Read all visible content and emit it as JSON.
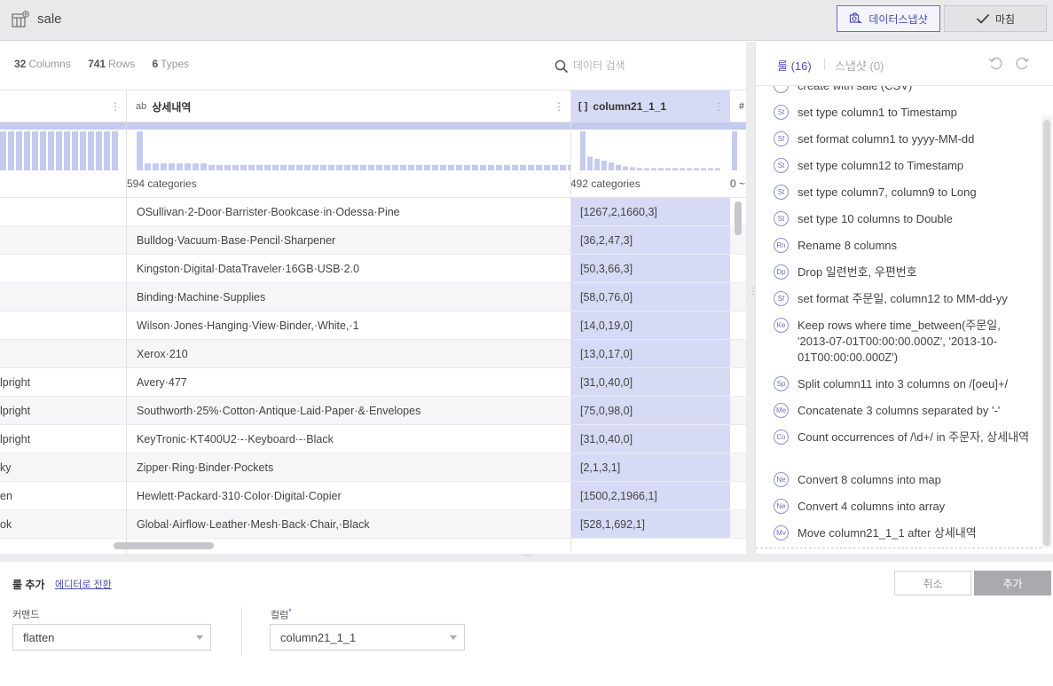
{
  "header": {
    "dataset_title": "sale",
    "snapshot_button": "데이터스냅샷",
    "finish_button": "마침"
  },
  "stats": {
    "columns_count": "32",
    "columns_label": "Columns",
    "rows_count": "741",
    "rows_label": "Rows",
    "types_count": "6",
    "types_label": "Types"
  },
  "search": {
    "placeholder": "데이터 검색"
  },
  "columns": [
    {
      "type": "ab",
      "name": "상세내역",
      "categories": "594 categories"
    },
    {
      "type": "[ ]",
      "name": "column21_1_1",
      "categories": "492 categories"
    },
    {
      "name": "#",
      "categories": "0 ~"
    }
  ],
  "rows": [
    {
      "left": "",
      "desc": "OSullivan·2-Door·Barrister·Bookcase·in·Odessa·Pine",
      "arr": "[1267,2,1660,3]"
    },
    {
      "left": "",
      "desc": "Bulldog·Vacuum·Base·Pencil·Sharpener",
      "arr": "[36,2,47,3]"
    },
    {
      "left": "",
      "desc": "Kingston·Digital·DataTraveler·16GB·USB·2.0",
      "arr": "[50,3,66,3]"
    },
    {
      "left": "",
      "desc": "Binding·Machine·Supplies",
      "arr": "[58,0,76,0]"
    },
    {
      "left": "",
      "desc": "Wilson·Jones·Hanging·View·Binder,·White,·1",
      "arr": "[14,0,19,0]"
    },
    {
      "left": "",
      "desc": "Xerox·210",
      "arr": "[13,0,17,0]"
    },
    {
      "left": "lpright",
      "desc": "Avery·477",
      "arr": "[31,0,40,0]"
    },
    {
      "left": "lpright",
      "desc": "Southworth·25%·Cotton·Antique·Laid·Paper·&·Envelopes",
      "arr": "[75,0,98,0]"
    },
    {
      "left": "lpright",
      "desc": "KeyTronic·KT400U2·-·Keyboard·-·Black",
      "arr": "[31,0,40,0]"
    },
    {
      "left": "ky",
      "desc": "Zipper·Ring·Binder·Pockets",
      "arr": "[2,1,3,1]"
    },
    {
      "left": "en",
      "desc": "Hewlett·Packard·310·Color·Digital·Copier",
      "arr": "[1500,2,1966,1]"
    },
    {
      "left": "ok",
      "desc": "Global·Airflow·Leather·Mesh·Back·Chair,·Black",
      "arr": "[528,1,692,1]"
    }
  ],
  "histograms": {
    "left": [
      1,
      1,
      1,
      1,
      1,
      1,
      1,
      1,
      1,
      1,
      1,
      1,
      1,
      1,
      1
    ],
    "desc": [
      1,
      0.18,
      0.18,
      0.18,
      0.18,
      0.18,
      0.18,
      0.18,
      0.18,
      0.14,
      0.14,
      0.14,
      0.14,
      0.14,
      0.14,
      0.14,
      0.14,
      0.14,
      0.14,
      0.14,
      0.14,
      0.14,
      0.14,
      0.14,
      0.14,
      0.14,
      0.14,
      0.14,
      0.14,
      0.14,
      0.14,
      0.14,
      0.14,
      0.14,
      0.14,
      0.14,
      0.14,
      0.14,
      0.14,
      0.14,
      0.14,
      0.14,
      0.14,
      0.14,
      0.14,
      0.14,
      0.14,
      0.14,
      0.14,
      0.14,
      0.14,
      0.14,
      0.14,
      0.14,
      0.14
    ],
    "arr": [
      1,
      0.35,
      0.3,
      0.25,
      0.2,
      0.14,
      0.1,
      0.08,
      0.06,
      0.06,
      0.06,
      0.06,
      0.06,
      0.06,
      0.06,
      0.06,
      0.06,
      0.06,
      0.06,
      0.06
    ],
    "last": [
      1
    ]
  },
  "rules_panel": {
    "rules_tab": "룰 (16)",
    "snapshot_tab": "스냅샷 (0)",
    "items": [
      {
        "badge": "",
        "text": "create with sale (CSV)"
      },
      {
        "badge": "St",
        "text": "set type column1 to Timestamp"
      },
      {
        "badge": "Sf",
        "text": "set format column1 to yyyy-MM-dd"
      },
      {
        "badge": "St",
        "text": "set type column12 to Timestamp"
      },
      {
        "badge": "St",
        "text": "set type column7, column9 to Long"
      },
      {
        "badge": "St",
        "text": "set type 10 columns to Double"
      },
      {
        "badge": "Rn",
        "text": "Rename 8 columns"
      },
      {
        "badge": "Dp",
        "text": "Drop 일련번호, 우편번호"
      },
      {
        "badge": "Sf",
        "text": "set format 주문일, column12 to MM-dd-yy"
      },
      {
        "badge": "Ke",
        "text": "Keep rows where time_between(주문일, '2013-07-01T00:00:00.000Z', '2013-10-01T00:00:00.000Z')"
      },
      {
        "badge": "Sp",
        "text": "Split column11 into 3 columns on /[oeu]+/"
      },
      {
        "badge": "Me",
        "text": "Concatenate 3 columns separated by '-'"
      },
      {
        "badge": "Co",
        "text": "Count occurrences of /\\d+/ in 주문자, 상세내역"
      },
      {
        "badge": "Ne",
        "text": "Convert 8 columns into map"
      },
      {
        "badge": "Ne",
        "text": "Convert 4 columns into array"
      },
      {
        "badge": "Mv",
        "text": "Move column21_1_1 after 상세내역"
      }
    ]
  },
  "bottom": {
    "title": "룰 추가",
    "editor_link": "에디터로 전환",
    "cancel_button": "취소",
    "add_button": "추가",
    "command_label": "커맨드",
    "command_value": "flatten",
    "column_label": "컬럼",
    "column_required": "*",
    "column_value": "column21_1_1"
  },
  "colors": {
    "accent": "#4b50b3",
    "selected_column_bg": "#d6daf4",
    "histogram_bar": "#c5cbee"
  }
}
